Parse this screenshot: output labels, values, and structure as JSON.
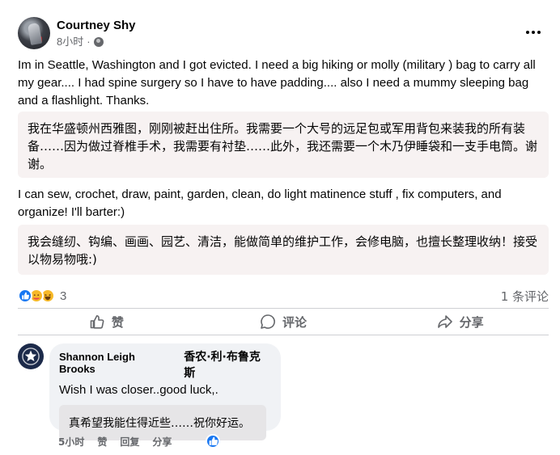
{
  "post": {
    "author": "Courtney Shy",
    "time": "8小时",
    "dot": "·",
    "body_en_1": "Im in Seattle,  Washington and I got evicted.  I need a big hiking or molly (military ) bag to carry all my gear.... I had spine surgery so I have to have padding.... also I need a mummy sleeping bag and a flashlight. Thanks.",
    "body_zh_1": "我在华盛顿州西雅图，刚刚被赶出住所。我需要一个大号的远足包或军用背包来装我的所有装备……因为做过脊椎手术，我需要有衬垫……此外，我还需要一个木乃伊睡袋和一支手电筒。谢谢。",
    "body_en_2": "I can sew, crochet, draw, paint, garden, clean, do light matinence stuff , fix computers, and organize! I'll barter:)",
    "body_zh_2": "我会缝纫、钩编、画画、园艺、清洁，能做简单的维护工作，会修电脑，也擅长整理收纳！接受以物易物哦:)"
  },
  "reactions": {
    "count": "3",
    "comments": "1 条评论"
  },
  "actions": {
    "like": "赞",
    "comment": "评论",
    "share": "分享"
  },
  "comment": {
    "name": "Shannon Leigh Brooks",
    "name_translated": "香农·利·布鲁克斯",
    "text": "Wish I was closer..good luck,.",
    "translation": "真希望我能住得近些……祝你好运。",
    "time": "5小时",
    "like": "赞",
    "reply": "回复",
    "share": "分享"
  },
  "colors": {
    "accent": "#1877f2",
    "muted_text": "#65676b",
    "translation_bg": "#f7f2f2"
  }
}
